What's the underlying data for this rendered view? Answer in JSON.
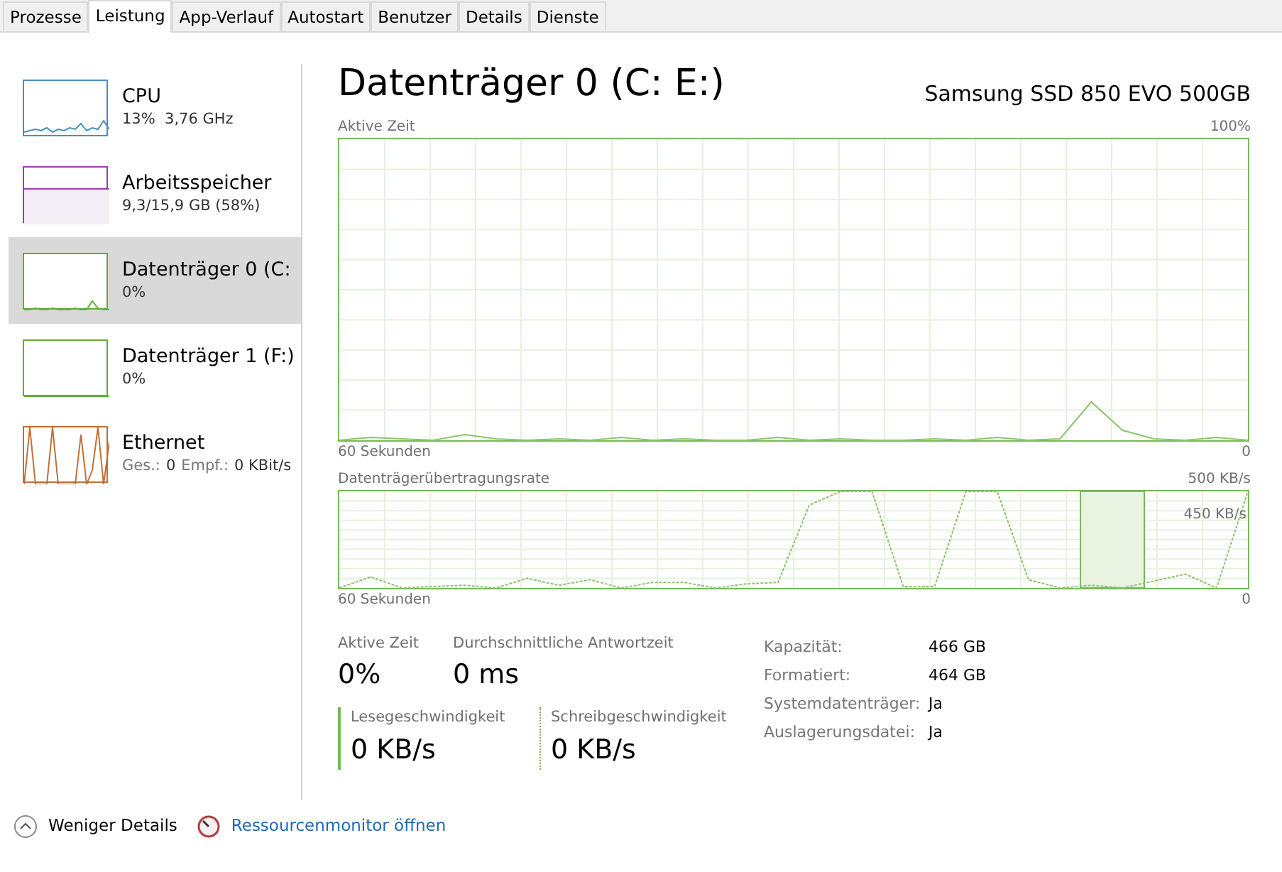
{
  "tabs": [
    {
      "label": "Prozesse",
      "selected": false
    },
    {
      "label": "Leistung",
      "selected": true
    },
    {
      "label": "App-Verlauf",
      "selected": false
    },
    {
      "label": "Autostart",
      "selected": false
    },
    {
      "label": "Benutzer",
      "selected": false
    },
    {
      "label": "Details",
      "selected": false
    },
    {
      "label": "Dienste",
      "selected": false
    }
  ],
  "sidebar": {
    "items": [
      {
        "title": "CPU",
        "detail": "13%  3,76 GHz",
        "color": "#4a90c0",
        "selected": false
      },
      {
        "title": "Arbeitsspeicher",
        "detail": "9,3/15,9 GB (58%)",
        "color": "#9b3fb0",
        "selected": false
      },
      {
        "title": "Datenträger 0 (C:",
        "detail": "0%",
        "color": "#5fae3a",
        "selected": true
      },
      {
        "title": "Datenträger 1 (F:)",
        "detail": "0%",
        "color": "#5fae3a",
        "selected": false
      },
      {
        "title": "Ethernet",
        "detail_parts": [
          {
            "label": "Ges.:",
            "value": "0"
          },
          {
            "label": "Empf.:",
            "value": "0 KBit/s"
          }
        ],
        "color": "#c0703a",
        "selected": false
      }
    ]
  },
  "main": {
    "title": "Datenträger 0 (C: E:)",
    "device": "Samsung SSD 850 EVO 500GB",
    "graphs": [
      {
        "label": "Aktive Zeit",
        "max": "100%",
        "time": "60 Sekunden",
        "min": "0"
      },
      {
        "label": "Datenträgerübertragungsrate",
        "max": "500 KB/s",
        "inner_label": "450 KB/s",
        "time": "60 Sekunden",
        "min": "0"
      }
    ],
    "stats": [
      {
        "label": "Aktive Zeit",
        "value": "0%"
      },
      {
        "label": "Durchschnittliche Antwortzeit",
        "value": "0 ms"
      }
    ],
    "speeds": [
      {
        "label": "Lesegeschwindigkeit",
        "value": "0 KB/s",
        "kind": "solid"
      },
      {
        "label": "Schreibgeschwindigkeit",
        "value": "0 KB/s",
        "kind": "dotted"
      }
    ],
    "properties": [
      {
        "label": "Kapazität:",
        "value": "466 GB"
      },
      {
        "label": "Formatiert:",
        "value": "464 GB"
      },
      {
        "label": "Systemdatenträger:",
        "value": "Ja"
      },
      {
        "label": "Auslagerungsdatei:",
        "value": "Ja"
      }
    ]
  },
  "footer": {
    "less_details": "Weniger Details",
    "resource_monitor": "Ressourcenmonitor öffnen"
  }
}
